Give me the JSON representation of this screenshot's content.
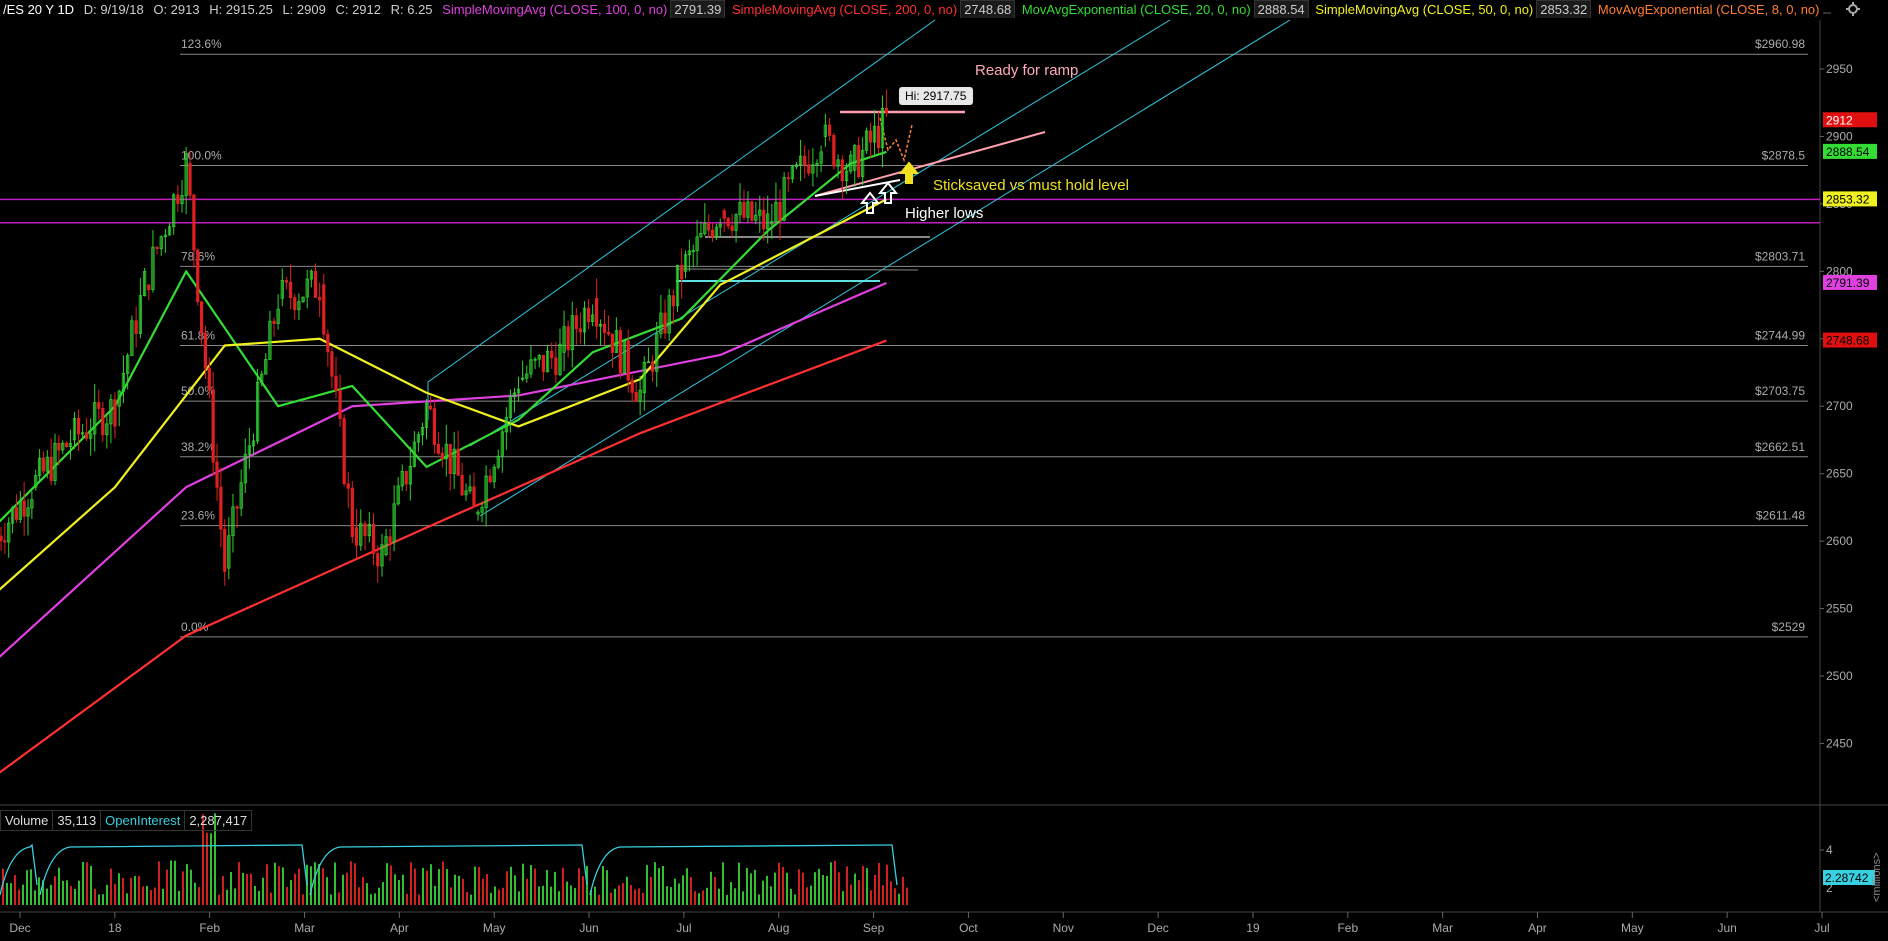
{
  "header": {
    "symbol": "/ES 20 Y 1D",
    "date": "D: 9/19/18",
    "open": "O: 2913",
    "high": "H: 2915.25",
    "low": "L: 2909",
    "close": "C: 2912",
    "range": "R: 6.25",
    "studies": [
      {
        "label": "SimpleMovingAvg (CLOSE, 100, 0, no)",
        "value": "2791.39",
        "color": "#e040e0"
      },
      {
        "label": "SimpleMovingAvg (CLOSE, 200, 0, no)",
        "value": "2748.68",
        "color": "#ff3030"
      },
      {
        "label": "MovAvgExponential (CLOSE, 20, 0, no)",
        "value": "2888.54",
        "color": "#33dd33"
      },
      {
        "label": "SimpleMovingAvg (CLOSE, 50, 0, no)",
        "value": "2853.32",
        "color": "#f0f020"
      },
      {
        "label": "MovAvgExponential (CLOSE, 8, 0, no)",
        "value": "",
        "color": "#ff7f30"
      }
    ],
    "settings_icon": "gear-icon"
  },
  "volume_panel": {
    "volume_label": "Volume",
    "volume_value": "35,113",
    "oi_label": "OpenInterest",
    "oi_value": "2,287,417",
    "oi_axis_label": "2.28742",
    "axis_ticks": [
      "4",
      "2"
    ],
    "axis_unit": "<millions>"
  },
  "chart_data": {
    "type": "candlestick",
    "instrument": "/ES",
    "ylim": [
      2380,
      2990
    ],
    "y_ticks": [
      2450,
      2500,
      2550,
      2600,
      2650,
      2700,
      2750,
      2800,
      2850,
      2900,
      2950
    ],
    "x_ticks": [
      "Dec",
      "18",
      "Feb",
      "Mar",
      "Apr",
      "May",
      "Jun",
      "Jul",
      "Aug",
      "Sep",
      "Oct",
      "Nov",
      "Dec",
      "19",
      "Feb",
      "Mar",
      "Apr",
      "May",
      "Jun",
      "Jul"
    ],
    "price_series": {
      "dates": [
        "2017-11-22",
        "2017-12-05",
        "2017-12-18",
        "2018-01-02",
        "2018-01-12",
        "2018-01-26",
        "2018-02-08",
        "2018-02-26",
        "2018-03-12",
        "2018-03-23",
        "2018-04-02",
        "2018-04-17",
        "2018-05-03",
        "2018-05-18",
        "2018-06-01",
        "2018-06-12",
        "2018-06-28",
        "2018-07-12",
        "2018-07-25",
        "2018-08-10",
        "2018-08-28",
        "2018-09-07",
        "2018-09-19"
      ],
      "values": [
        2600,
        2640,
        2675,
        2700,
        2790,
        2880,
        2580,
        2780,
        2790,
        2610,
        2590,
        2700,
        2620,
        2720,
        2740,
        2780,
        2710,
        2800,
        2845,
        2835,
        2900,
        2875,
        2912
      ]
    },
    "moving_averages": [
      {
        "name": "SimpleMovingAvg (CLOSE, 100, 0, no)",
        "color": "#e040e0",
        "dates": [
          "2017-11-22",
          "2018-01-26",
          "2018-03-23",
          "2018-05-18",
          "2018-07-25",
          "2018-09-19"
        ],
        "values": [
          2510,
          2640,
          2700,
          2708,
          2738,
          2791.39
        ]
      },
      {
        "name": "SimpleMovingAvg (CLOSE, 200, 0, no)",
        "color": "#ff3030",
        "dates": [
          "2017-11-22",
          "2018-01-26",
          "2018-04-17",
          "2018-06-28",
          "2018-09-19"
        ],
        "values": [
          2425,
          2530,
          2610,
          2680,
          2748.68
        ]
      },
      {
        "name": "MovAvgExponential (CLOSE, 20, 0, no)",
        "color": "#33dd33",
        "dates": [
          "2017-11-22",
          "2018-01-02",
          "2018-01-26",
          "2018-02-26",
          "2018-03-23",
          "2018-04-17",
          "2018-05-18",
          "2018-06-12",
          "2018-07-12",
          "2018-08-10",
          "2018-09-07",
          "2018-09-19"
        ],
        "values": [
          2610,
          2700,
          2800,
          2700,
          2715,
          2655,
          2690,
          2740,
          2765,
          2830,
          2880,
          2888.54
        ]
      },
      {
        "name": "SimpleMovingAvg (CLOSE, 50, 0, no)",
        "color": "#f0f020",
        "dates": [
          "2017-11-22",
          "2018-01-02",
          "2018-02-08",
          "2018-03-12",
          "2018-04-17",
          "2018-05-18",
          "2018-06-28",
          "2018-07-25",
          "2018-09-19"
        ],
        "values": [
          2560,
          2640,
          2745,
          2750,
          2710,
          2685,
          2720,
          2790,
          2853.32
        ]
      }
    ],
    "fibonacci_levels": [
      {
        "label": "123.6%",
        "price": 2960.98,
        "value_label": "$2960.98"
      },
      {
        "label": "100.0%",
        "price": 2878.5,
        "value_label": "$2878.5"
      },
      {
        "label": "78.6%",
        "price": 2803.71,
        "value_label": "$2803.71"
      },
      {
        "label": "61.8%",
        "price": 2744.99,
        "value_label": "$2744.99"
      },
      {
        "label": "50.0%",
        "price": 2703.75,
        "value_label": "$2703.75"
      },
      {
        "label": "38.2%",
        "price": 2662.51,
        "value_label": "$2662.51"
      },
      {
        "label": "23.6%",
        "price": 2611.48,
        "value_label": "$2611.48"
      },
      {
        "label": "0.0%",
        "price": 2529,
        "value_label": "$2529"
      }
    ],
    "horizontal_levels": [
      2853.32,
      2836
    ],
    "price_labels": [
      {
        "text": "2912",
        "price": 2912,
        "bg": "#e01010",
        "fg": "#ffffff"
      },
      {
        "text": "2888.54",
        "price": 2888.54,
        "bg": "#33dd33",
        "fg": "#000000"
      },
      {
        "text": "2853.32",
        "price": 2853.32,
        "bg": "#f0f020",
        "fg": "#000000"
      },
      {
        "text": "2791.39",
        "price": 2791.39,
        "bg": "#e040e0",
        "fg": "#000000"
      },
      {
        "text": "2748.68",
        "price": 2748.68,
        "bg": "#e01010",
        "fg": "#000000"
      }
    ],
    "annotations": [
      {
        "text": "Ready for ramp",
        "color": "#ffaabb"
      },
      {
        "text": "Hi: 2917.75",
        "color": "#000000"
      },
      {
        "text": "Sticksaved vs must hold level",
        "color": "#f0e020"
      },
      {
        "text": "Higher lows",
        "color": "#ffffff"
      }
    ],
    "grid": false
  }
}
